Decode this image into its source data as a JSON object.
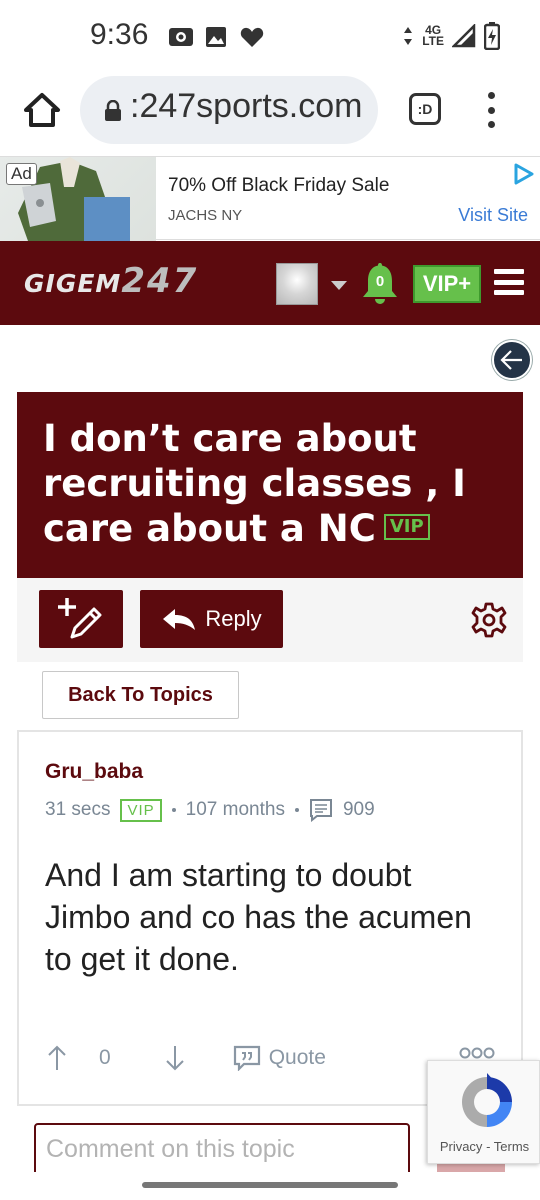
{
  "status_bar": {
    "time": "9:36",
    "network_label_top": "4G",
    "network_label_bottom": "LTE"
  },
  "browser": {
    "url": ":247sports.com",
    "tabs_count": ":D"
  },
  "ad": {
    "tag": "Ad",
    "title": "70% Off Black Friday Sale",
    "advertiser": "JACHS NY",
    "cta": "Visit Site"
  },
  "site_header": {
    "logo_text": "GIGEM",
    "logo_number": "247",
    "notification_count": "0",
    "vip_button": "VIP+",
    "brand_color": "#5c0a0e",
    "accent_color": "#66c04b"
  },
  "thread": {
    "title": "I don’t care about recruiting classes , I care about a NC",
    "badge": "VIP",
    "reply_label": "Reply",
    "back_to_topics": "Back To Topics"
  },
  "post": {
    "author": "Gru_baba",
    "time_ago": "31 secs",
    "badge": "VIP",
    "membership": "107 months",
    "post_count": "909",
    "body": "And I am starting to doubt Jimbo and co has the acumen to get it done.",
    "vote_count": "0",
    "quote_label": "Quote"
  },
  "comment": {
    "placeholder": "Comment on this topic"
  },
  "recaptcha": {
    "privacy": "Privacy",
    "separator": "-",
    "terms": "Terms"
  }
}
